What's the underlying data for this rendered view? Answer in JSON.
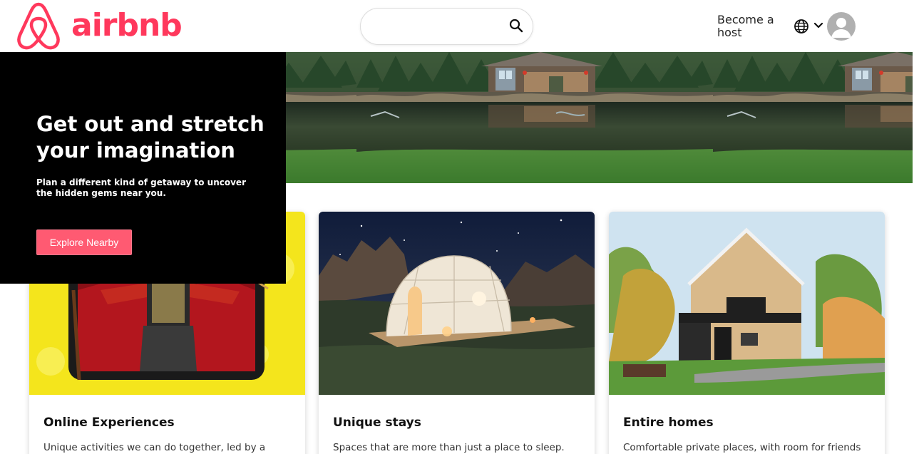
{
  "header": {
    "brand": "airbnb",
    "search": {
      "value": "",
      "placeholder": ""
    },
    "host_link": "Become a host",
    "icons": [
      "airbnb-logo-icon",
      "search-icon",
      "globe-icon",
      "chevron-down-icon",
      "avatar-icon"
    ]
  },
  "hero": {
    "title": "Get out and stretch your imagination",
    "subtitle": "Plan a different kind of getaway to uncover the hidden gems near you.",
    "cta": "Explore Nearby"
  },
  "cards": [
    {
      "title": "Online Experiences",
      "description": "Unique activities we can do together, led by a world of hosts."
    },
    {
      "title": "Unique stays",
      "description": "Spaces that are more than just a place to sleep."
    },
    {
      "title": "Entire homes",
      "description": "Comfortable private places, with room for friends or family."
    }
  ],
  "colors": {
    "brand": "#ff385c",
    "cta": "#ff5a72",
    "hero_bg": "#000000"
  }
}
